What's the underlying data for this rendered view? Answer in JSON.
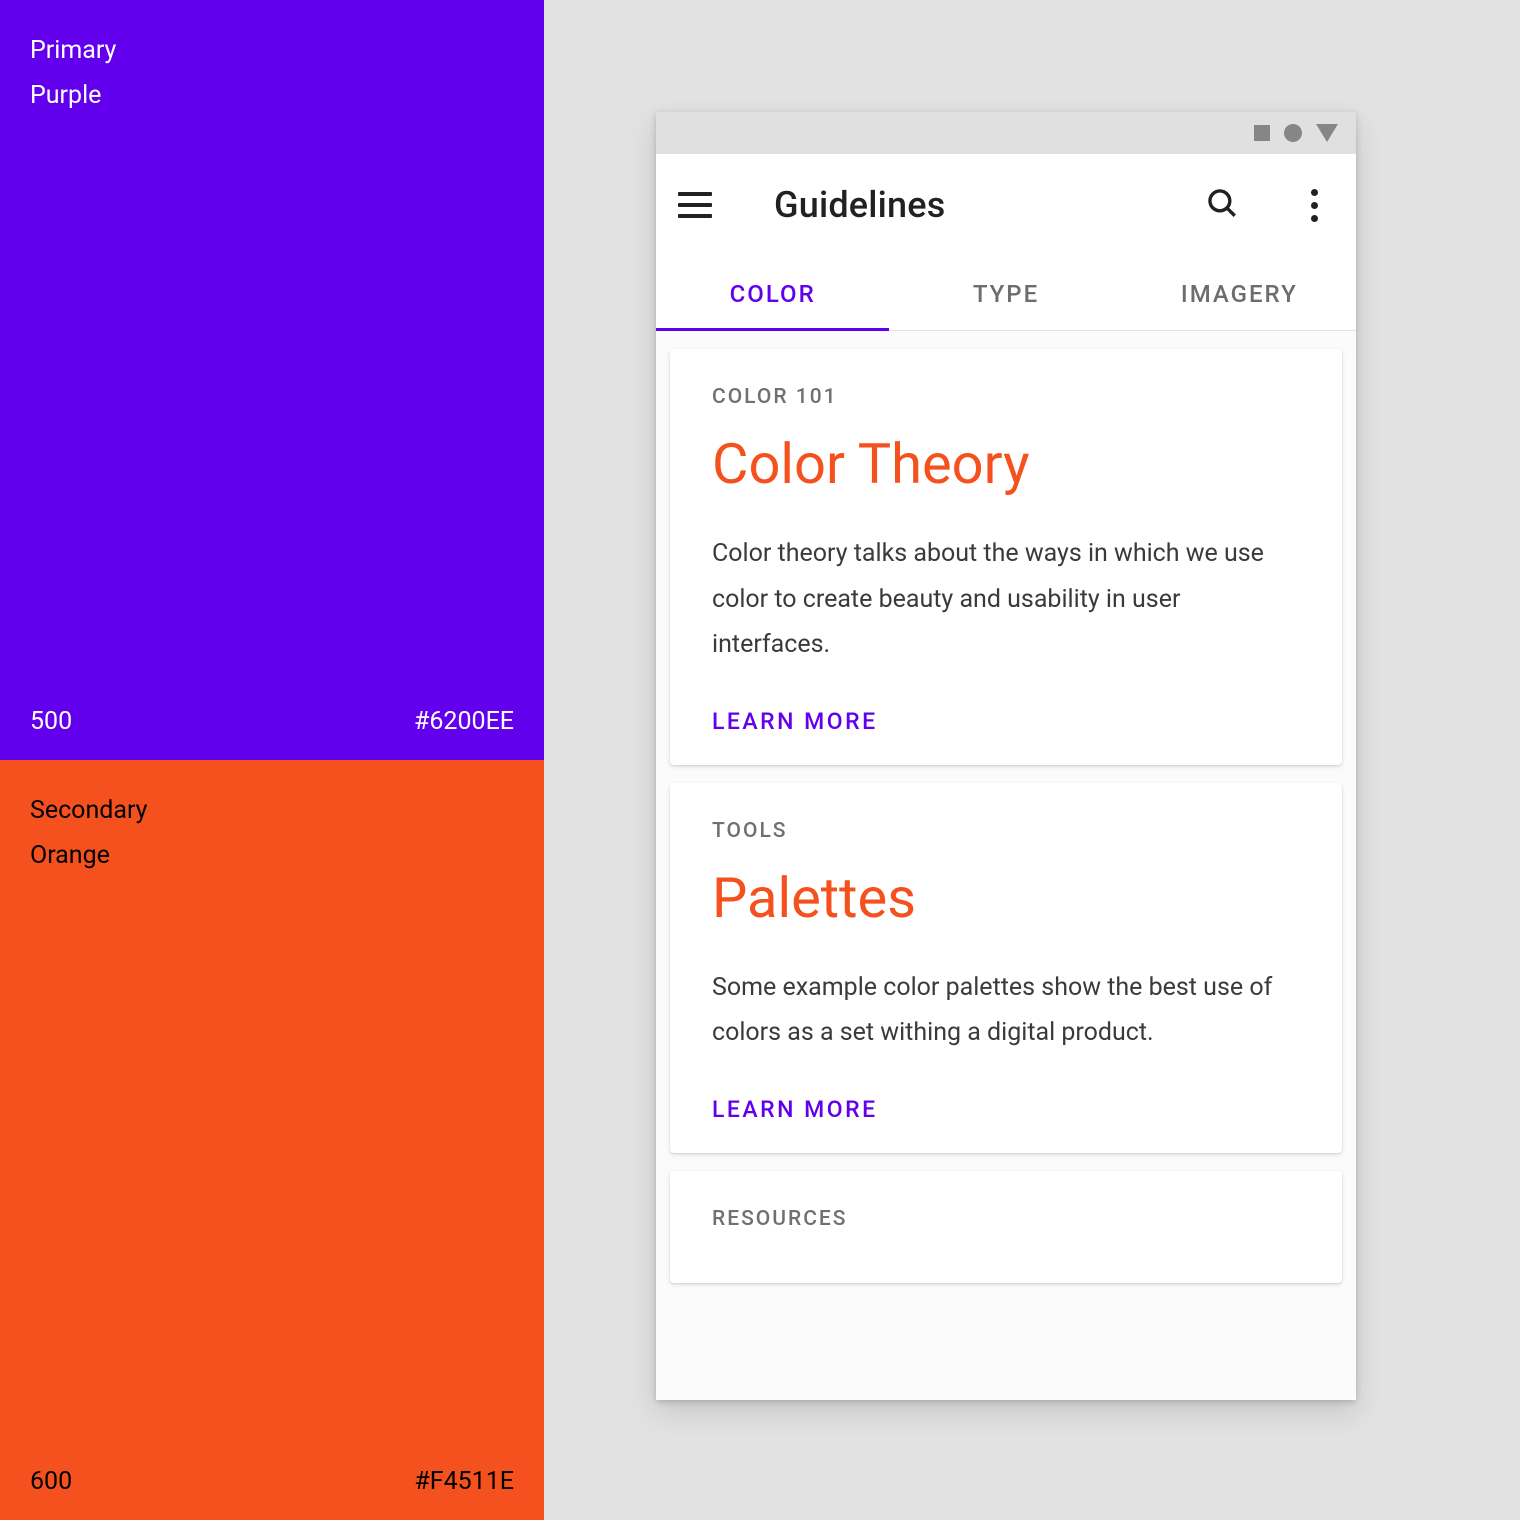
{
  "palette": {
    "primary": {
      "role": "Primary",
      "name": "Purple",
      "shade": "500",
      "hex": "#6200EE"
    },
    "secondary": {
      "role": "Secondary",
      "name": "Orange",
      "shade": "600",
      "hex": "#F4511E"
    }
  },
  "statusbar": {
    "icons": [
      "square",
      "circle",
      "triangle"
    ]
  },
  "appbar": {
    "title": "Guidelines"
  },
  "tabs": [
    {
      "label": "COLOR",
      "active": true
    },
    {
      "label": "TYPE",
      "active": false
    },
    {
      "label": "IMAGERY",
      "active": false
    }
  ],
  "cards": [
    {
      "overline": "COLOR 101",
      "title": "Color Theory",
      "body": "Color theory talks about the ways in which we use color to create beauty and usability in user interfaces.",
      "action": "LEARN MORE"
    },
    {
      "overline": "TOOLS",
      "title": "Palettes",
      "body": "Some example color palettes show the best use of colors as a set withing a digital product.",
      "action": "LEARN MORE"
    },
    {
      "overline": "RESOURCES",
      "title": "",
      "body": "",
      "action": ""
    }
  ],
  "colors": {
    "accent": "#6200EE",
    "secondary_accent": "#F4511E"
  }
}
